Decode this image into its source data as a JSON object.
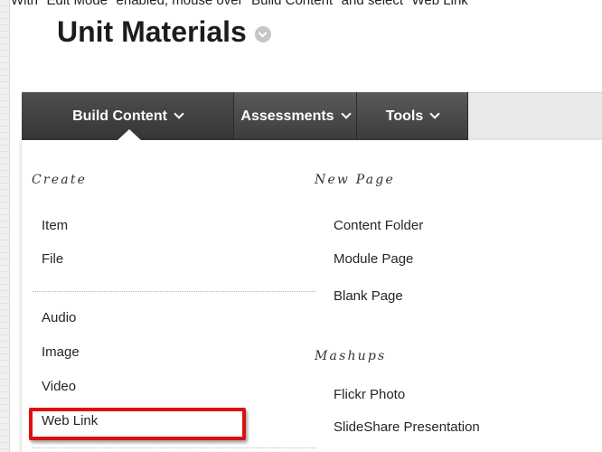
{
  "instruction": "With \"Edit Mode\" enabled, mouse over \"Build Content\" and select \"Web Link\"",
  "page": {
    "title": "Unit Materials"
  },
  "menu_bar": {
    "tabs": [
      {
        "label": "Build Content"
      },
      {
        "label": "Assessments"
      },
      {
        "label": "Tools"
      }
    ]
  },
  "dropdown": {
    "create": {
      "heading": "Create",
      "group1": [
        "Item",
        "File"
      ],
      "group2": [
        "Audio",
        "Image",
        "Video",
        "Web Link"
      ]
    },
    "new_page": {
      "heading": "New Page",
      "items": [
        "Content Folder",
        "Module Page",
        "Blank Page"
      ]
    },
    "mashups": {
      "heading": "Mashups",
      "items": [
        "Flickr Photo",
        "SlideShare Presentation"
      ]
    }
  },
  "colors": {
    "highlight": "#dd1010",
    "tab_bg": "#4a4a4a",
    "action_bar_bg": "#e9e9e9"
  }
}
